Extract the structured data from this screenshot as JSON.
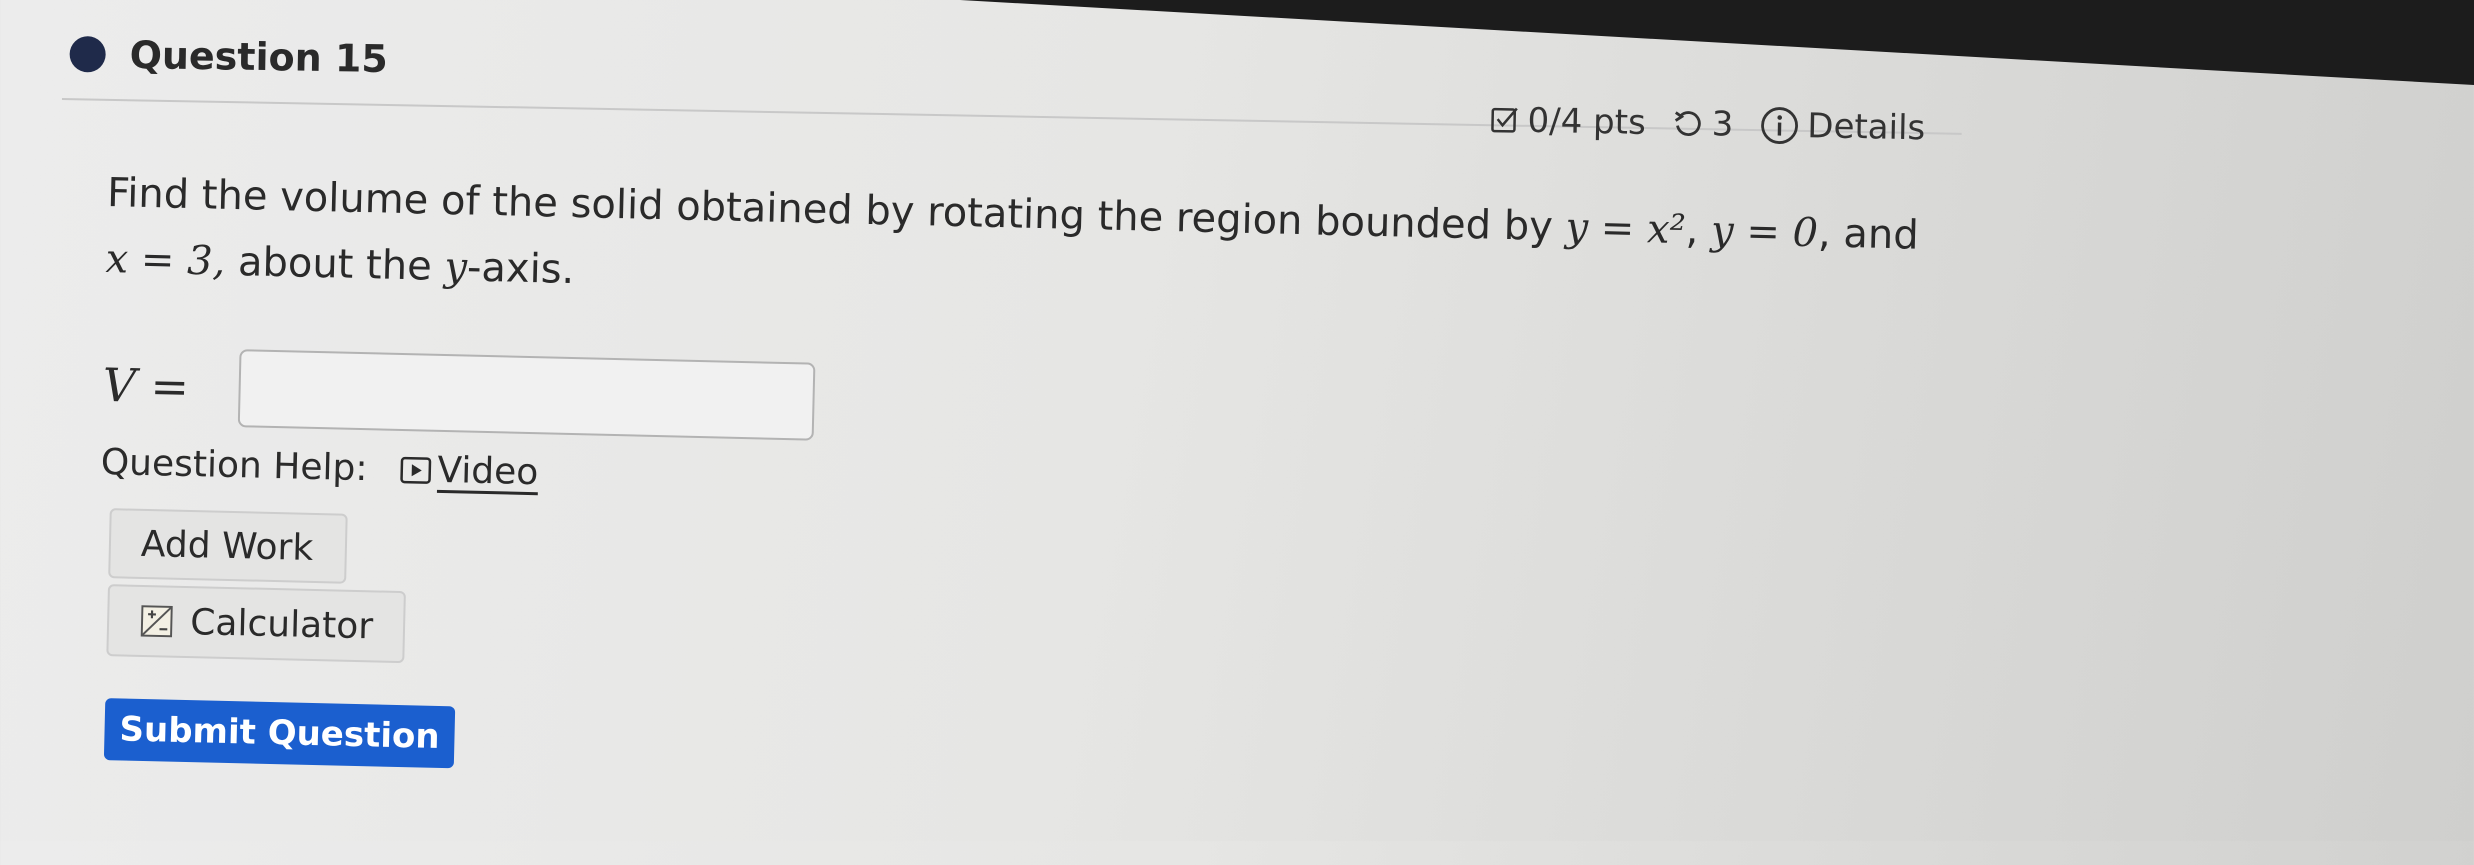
{
  "question": {
    "title": "Question 15"
  },
  "meta": {
    "points": "0/4 pts",
    "attempts": "3",
    "details_label": "Details"
  },
  "prompt": {
    "text_before": "Find the volume of the solid obtained by rotating the region bounded by ",
    "eq1": "y = x²",
    "sep1": ", ",
    "eq2": "y = 0",
    "sep2": ", and ",
    "eq3": "x = 3,",
    "text_after": " about the ",
    "axis_var": "y",
    "text_end": "-axis."
  },
  "answer": {
    "label": "V =",
    "value": ""
  },
  "help": {
    "label": "Question Help:",
    "video_label": "Video"
  },
  "buttons": {
    "add_work": "Add Work",
    "calculator": "Calculator",
    "submit": "Submit Question"
  },
  "colors": {
    "submit_bg": "#1b5fcf",
    "bullet": "#1f2a4a"
  },
  "icons": {
    "points": "checkbox-icon",
    "attempts": "retry-icon",
    "details": "info-icon",
    "video": "play-icon",
    "calculator": "calculator-icon"
  }
}
